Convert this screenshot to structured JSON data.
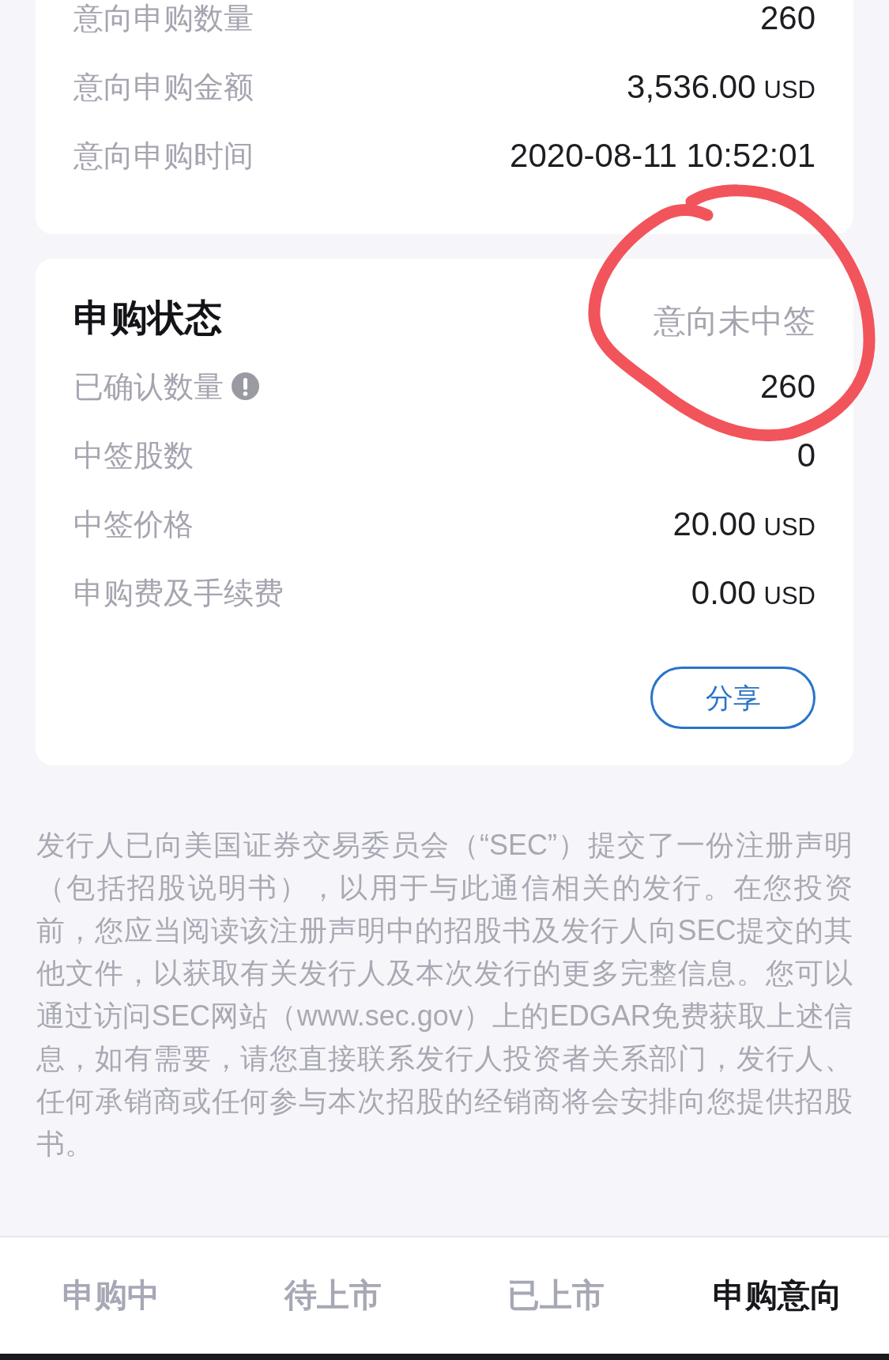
{
  "intent_details": {
    "rows": [
      {
        "label": "意向申购数量",
        "value": "260"
      },
      {
        "label": "意向申购金额",
        "value": "3,536.00",
        "unit": "USD"
      },
      {
        "label": "意向申购时间",
        "value": "2020-08-11 10:52:01"
      }
    ]
  },
  "subscription_status": {
    "title": "申购状态",
    "status": "意向未中签",
    "rows": [
      {
        "label": "已确认数量",
        "value": "260",
        "info": true
      },
      {
        "label": "中签股数",
        "value": "0",
        "info": false
      },
      {
        "label": "中签价格",
        "value": "20.00",
        "unit": "USD",
        "info": false
      },
      {
        "label": "申购费及手续费",
        "value": "0.00",
        "unit": "USD",
        "info": false
      }
    ],
    "share_button": "分享"
  },
  "disclaimer": "发行人已向美国证券交易委员会（“SEC”）提交了一份注册声明（包括招股说明书），以用于与此通信相关的发行。在您投资前，您应当阅读该注册声明中的招股书及发行人向SEC提交的其他文件，以获取有关发行人及本次发行的更多完整信息。您可以通过访问SEC网站（www.sec.gov）上的EDGAR免费获取上述信息，如有需要，请您直接联系发行人投资者关系部门，发行人、任何承销商或任何参与本次招股的经销商将会安排向您提供招股书。",
  "tabs": [
    {
      "label": "申购中",
      "selected": false
    },
    {
      "label": "待上市",
      "selected": false
    },
    {
      "label": "已上市",
      "selected": false
    },
    {
      "label": "申购意向",
      "selected": true
    }
  ]
}
